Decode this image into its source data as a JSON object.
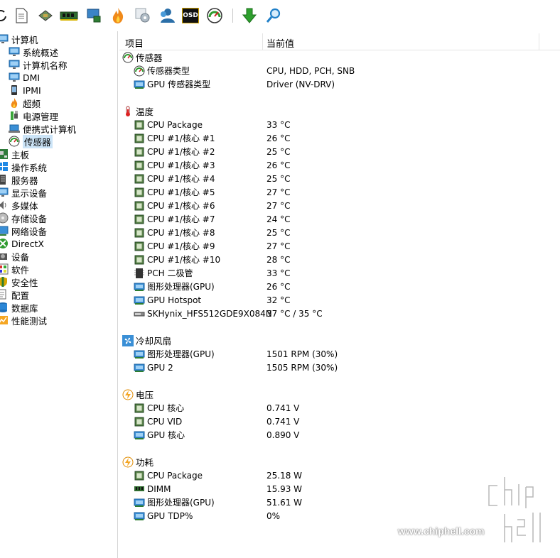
{
  "columns": {
    "item": "项目",
    "value": "当前值"
  },
  "tree": [
    {
      "label": "计算机",
      "level": 0,
      "icon": "computer-icon"
    },
    {
      "label": "系统概述",
      "level": 1,
      "icon": "monitor-icon"
    },
    {
      "label": "计算机名称",
      "level": 1,
      "icon": "monitor-icon"
    },
    {
      "label": "DMI",
      "level": 1,
      "icon": "monitor-icon"
    },
    {
      "label": "IPMI",
      "level": 1,
      "icon": "phone-icon"
    },
    {
      "label": "超频",
      "level": 1,
      "icon": "flame-icon"
    },
    {
      "label": "电源管理",
      "level": 1,
      "icon": "power-plug-icon"
    },
    {
      "label": "便携式计算机",
      "level": 1,
      "icon": "laptop-icon"
    },
    {
      "label": "传感器",
      "level": 1,
      "icon": "gauge-icon",
      "selected": true
    },
    {
      "label": "主板",
      "level": 0,
      "icon": "motherboard-icon"
    },
    {
      "label": "操作系统",
      "level": 0,
      "icon": "windows-icon"
    },
    {
      "label": "服务器",
      "level": 0,
      "icon": "server-icon"
    },
    {
      "label": "显示设备",
      "level": 0,
      "icon": "display-icon"
    },
    {
      "label": "多媒体",
      "level": 0,
      "icon": "speaker-icon"
    },
    {
      "label": "存储设备",
      "level": 0,
      "icon": "disk-icon"
    },
    {
      "label": "网络设备",
      "level": 0,
      "icon": "network-icon"
    },
    {
      "label": "DirectX",
      "level": 0,
      "icon": "xbox-icon"
    },
    {
      "label": "设备",
      "level": 0,
      "icon": "device-icon"
    },
    {
      "label": "软件",
      "level": 0,
      "icon": "software-icon"
    },
    {
      "label": "安全性",
      "level": 0,
      "icon": "shield-icon"
    },
    {
      "label": "配置",
      "level": 0,
      "icon": "config-icon"
    },
    {
      "label": "数据库",
      "level": 0,
      "icon": "database-icon"
    },
    {
      "label": "性能测试",
      "level": 0,
      "icon": "benchmark-icon"
    }
  ],
  "groups": [
    {
      "title": "传感器",
      "icon": "gauge-icon",
      "rows": [
        {
          "item": "传感器类型",
          "value": "CPU, HDD, PCH, SNB",
          "icon": "gauge-icon"
        },
        {
          "item": "GPU 传感器类型",
          "value": "Driver  (NV-DRV)",
          "icon": "gpu-icon"
        }
      ]
    },
    {
      "title": "温度",
      "icon": "thermometer-icon",
      "rows": [
        {
          "item": "CPU Package",
          "value": "33 °C",
          "icon": "cpu-icon"
        },
        {
          "item": "CPU #1/核心 #1",
          "value": "26 °C",
          "icon": "cpu-icon"
        },
        {
          "item": "CPU #1/核心 #2",
          "value": "25 °C",
          "icon": "cpu-icon"
        },
        {
          "item": "CPU #1/核心 #3",
          "value": "26 °C",
          "icon": "cpu-icon"
        },
        {
          "item": "CPU #1/核心 #4",
          "value": "25 °C",
          "icon": "cpu-icon"
        },
        {
          "item": "CPU #1/核心 #5",
          "value": "27 °C",
          "icon": "cpu-icon"
        },
        {
          "item": "CPU #1/核心 #6",
          "value": "27 °C",
          "icon": "cpu-icon"
        },
        {
          "item": "CPU #1/核心 #7",
          "value": "24 °C",
          "icon": "cpu-icon"
        },
        {
          "item": "CPU #1/核心 #8",
          "value": "25 °C",
          "icon": "cpu-icon"
        },
        {
          "item": "CPU #1/核心 #9",
          "value": "27 °C",
          "icon": "cpu-icon"
        },
        {
          "item": "CPU #1/核心 #10",
          "value": "28 °C",
          "icon": "cpu-icon"
        },
        {
          "item": "PCH 二极管",
          "value": "33 °C",
          "icon": "chip-icon"
        },
        {
          "item": "图形处理器(GPU)",
          "value": "26 °C",
          "icon": "gpu-icon"
        },
        {
          "item": "GPU Hotspot",
          "value": "32 °C",
          "icon": "gpu-icon"
        },
        {
          "item": "SKHynix_HFS512GDE9X084N",
          "value": "37 °C / 35 °C",
          "icon": "ssd-icon"
        }
      ]
    },
    {
      "title": "冷却风扇",
      "icon": "fan-icon",
      "rows": [
        {
          "item": "图形处理器(GPU)",
          "value": "1501 RPM  (30%)",
          "icon": "gpu-icon"
        },
        {
          "item": "GPU 2",
          "value": "1505 RPM  (30%)",
          "icon": "gpu-icon"
        }
      ]
    },
    {
      "title": "电压",
      "icon": "bolt-icon",
      "rows": [
        {
          "item": "CPU 核心",
          "value": "0.741 V",
          "icon": "cpu-icon"
        },
        {
          "item": "CPU VID",
          "value": "0.741 V",
          "icon": "cpu-icon"
        },
        {
          "item": "GPU 核心",
          "value": "0.890 V",
          "icon": "gpu-icon"
        }
      ]
    },
    {
      "title": "功耗",
      "icon": "bolt-icon",
      "rows": [
        {
          "item": "CPU Package",
          "value": "25.18 W",
          "icon": "cpu-icon"
        },
        {
          "item": "DIMM",
          "value": "15.93 W",
          "icon": "ram-icon"
        },
        {
          "item": "图形处理器(GPU)",
          "value": "51.61 W",
          "icon": "gpu-icon"
        },
        {
          "item": "GPU TDP%",
          "value": "0%",
          "icon": "gpu-icon"
        }
      ]
    }
  ],
  "toolbar": {
    "osd_label": "OSD",
    "buttons": [
      "refresh-icon",
      "report-icon",
      "cpu-chip-icon",
      "ram-module-icon",
      "network-card-icon",
      "flame-icon",
      "settings-icon",
      "user-icon",
      "osd-icon",
      "sensor-gauge-icon",
      "download-icon",
      "search-icon"
    ]
  },
  "watermark": {
    "site": "www.chiphell.com",
    "logo": "chip hell"
  }
}
